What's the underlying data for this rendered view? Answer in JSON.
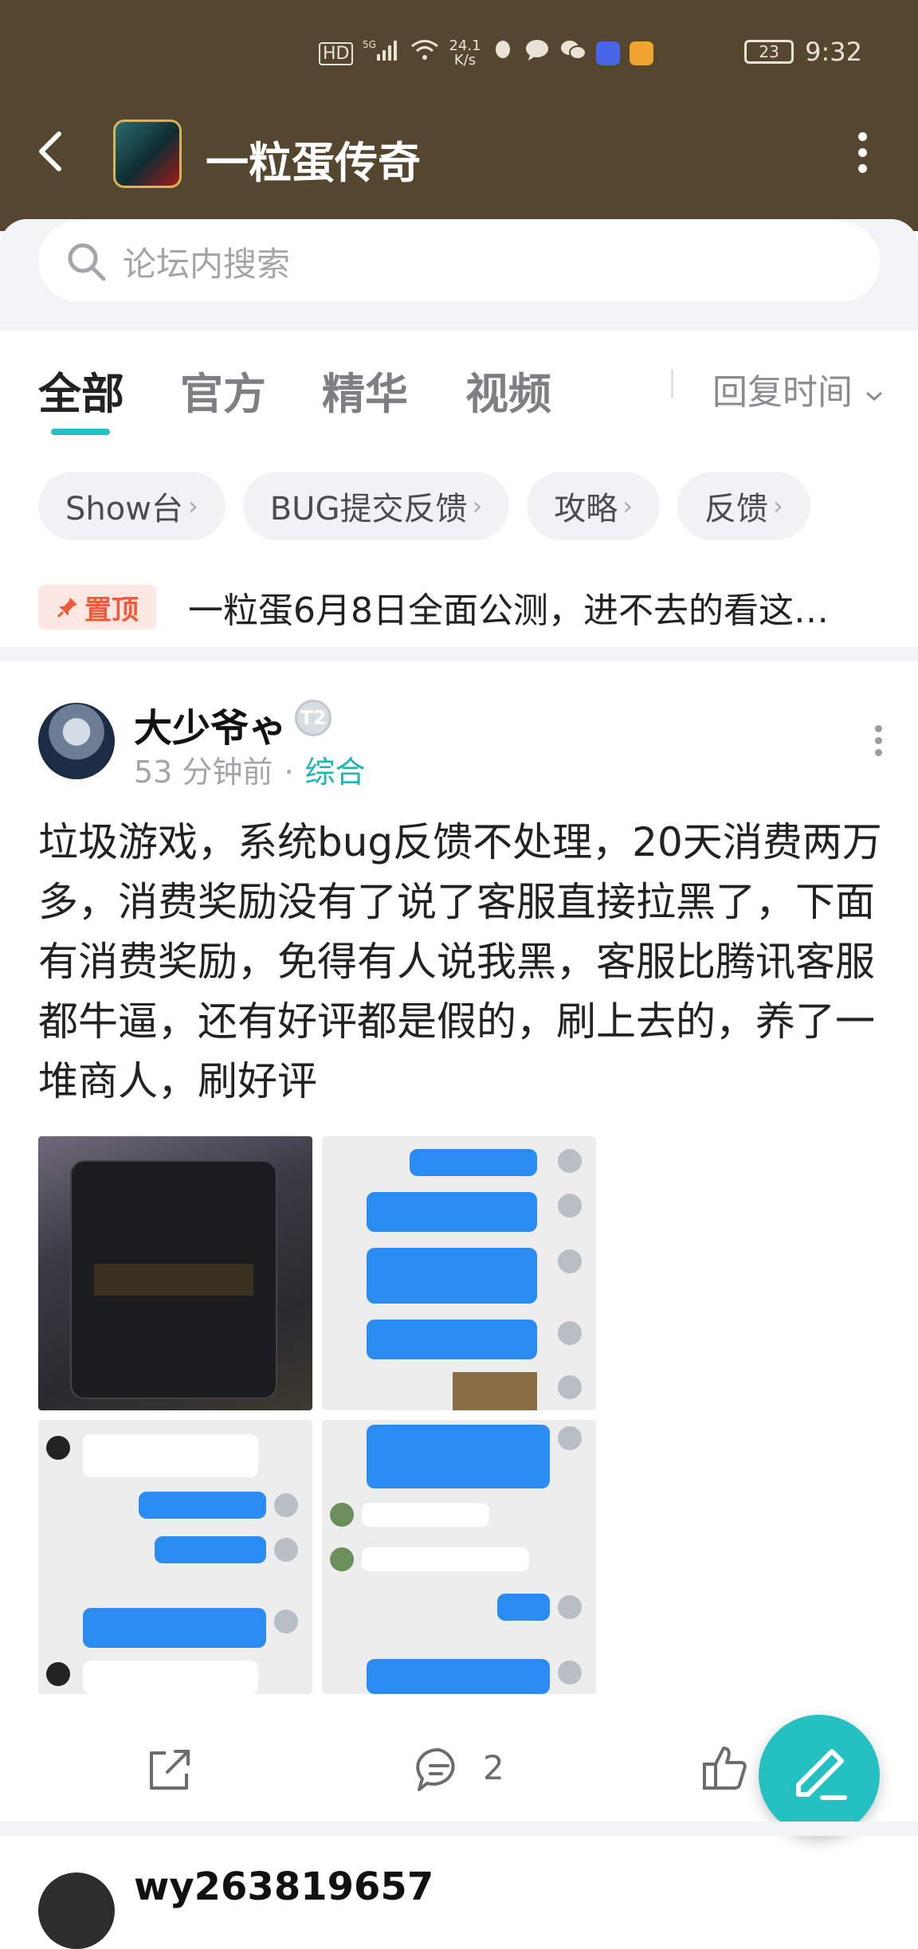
{
  "status_bar": {
    "network": "HD",
    "signal_label": "5G",
    "speed": "24.1",
    "speed_unit": "K/s",
    "battery": "23",
    "time": "9:32"
  },
  "header": {
    "title": "一粒蛋传奇"
  },
  "search": {
    "placeholder": "论坛内搜索"
  },
  "tabs": [
    {
      "label": "全部",
      "active": true
    },
    {
      "label": "官方",
      "active": false
    },
    {
      "label": "精华",
      "active": false
    },
    {
      "label": "视频",
      "active": false
    }
  ],
  "sort": {
    "label": "回复时间"
  },
  "chips": [
    {
      "label": "Show台"
    },
    {
      "label": "BUG提交反馈"
    },
    {
      "label": "攻略"
    },
    {
      "label": "反馈"
    }
  ],
  "pinned": {
    "badge": "置顶",
    "text": "一粒蛋6月8日全面公测，进不去的看这…"
  },
  "post": {
    "author": "大少爷ゃ",
    "level": "T2",
    "time": "53 分钟前",
    "category": "综合",
    "body": "垃圾游戏，系统bug反馈不处理，20天消费两万多，消费奖励没有了说了客服直接拉黑了，下面有消费奖励，免得有人说我黑，客服比腾讯客服都牛逼，还有好评都是假的，刷上去的，养了一堆商人，刷好评",
    "comment_count": "2"
  },
  "next_post": {
    "author": "wy263819657"
  },
  "colors": {
    "header_bg": "#54462f",
    "accent": "#21c2c3",
    "pin_badge": "#ef5a3b"
  }
}
